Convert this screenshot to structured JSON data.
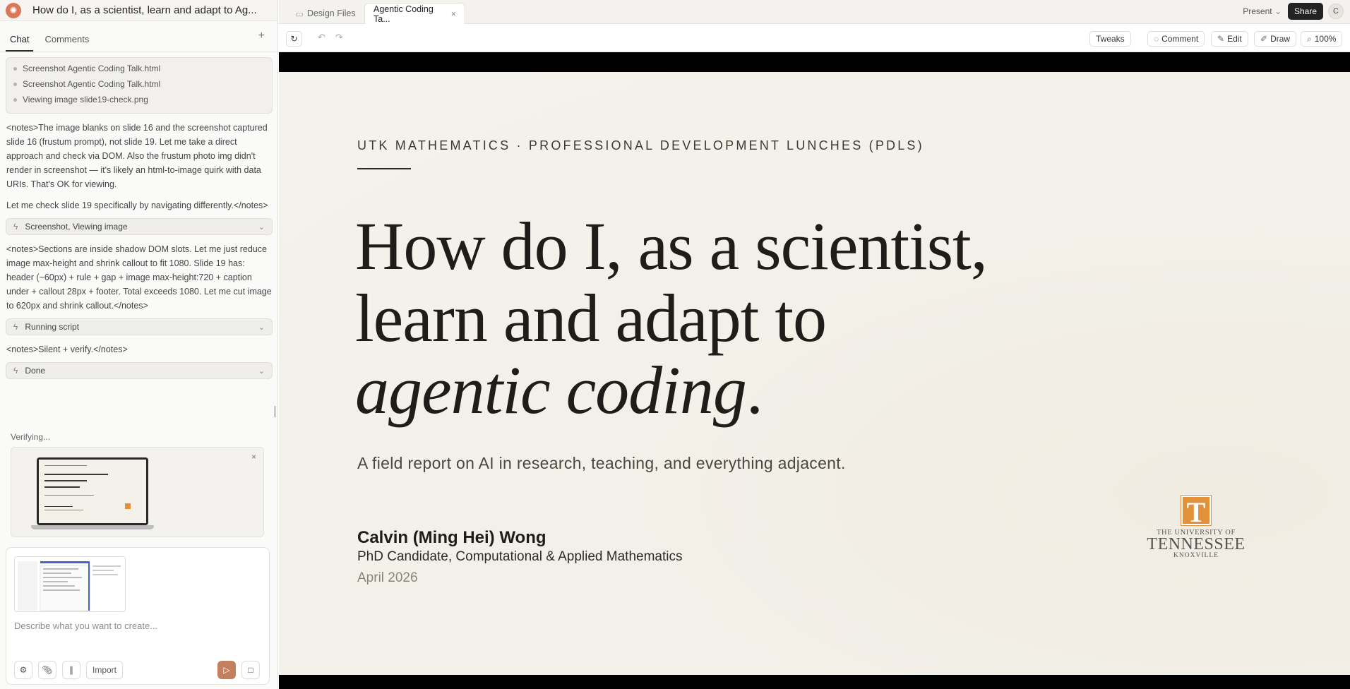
{
  "app": {
    "project_title": "How do I, as a scientist, learn and adapt to Ag..."
  },
  "left_tabs": {
    "chat": "Chat",
    "comments": "Comments",
    "new": "+"
  },
  "chat": {
    "tool_items": [
      "Screenshot Agentic Coding Talk.html",
      "Screenshot Agentic Coding Talk.html",
      "Viewing image slide19-check.png"
    ],
    "note1": "<notes>The image blanks on slide 16 and the screenshot captured slide 16 (frustum prompt), not slide 19. Let me take a direct approach and check via DOM. Also the frustum photo img didn't render in screenshot — it's likely an html-to-image quirk with data URIs. That's OK for viewing.",
    "note2": "Let me check slide 19 specifically by navigating differently.</notes>",
    "chip1": "Screenshot, Viewing image",
    "note3": "<notes>Sections are inside shadow DOM slots. Let me just reduce image max-height and shrink callout to fit 1080. Slide 19 has: header (~60px) + rule + gap + image max-height:720 + caption under + callout 28px + footer. Total exceeds 1080. Let me cut image to 620px and shrink callout.</notes>",
    "chip2": "Running script",
    "note4": "<notes>Silent + verify.</notes>",
    "chip3": "Done"
  },
  "verify": {
    "label": "Verifying...",
    "close": "×"
  },
  "composer": {
    "placeholder": "Describe what you want to create...",
    "import_label": "Import"
  },
  "file_tabs": {
    "design_files": "Design Files",
    "active_tab": "Agentic Coding Ta...",
    "close": "×"
  },
  "topbar": {
    "present": "Present",
    "share": "Share",
    "avatar_initial": "C"
  },
  "toolbar": {
    "tweaks": "Tweaks",
    "comment": "Comment",
    "edit": "Edit",
    "draw": "Draw",
    "zoom": "100%"
  },
  "slide": {
    "kicker": "UTK MATHEMATICS · PROFESSIONAL DEVELOPMENT LUNCHES (PDLS)",
    "headline_line1": "How do I, as a scientist,",
    "headline_line2": "learn and adapt to",
    "headline_line3_italic": "agentic coding",
    "headline_line3_end": ".",
    "subtitle": "A field report on AI in research, teaching, and everything adjacent.",
    "author": "Calvin (Ming Hei) Wong",
    "role": "PhD Candidate, Computational & Applied Mathematics",
    "date": "April 2026",
    "logo": {
      "letter": "T",
      "line1": "THE UNIVERSITY OF",
      "line2": "TENNESSEE",
      "line3": "KNOXVILLE"
    }
  },
  "colors": {
    "accent": "#d97757",
    "send_button": "#c4805d",
    "utk_orange": "#e2913a",
    "slide_bg": "#f4f2ec"
  }
}
